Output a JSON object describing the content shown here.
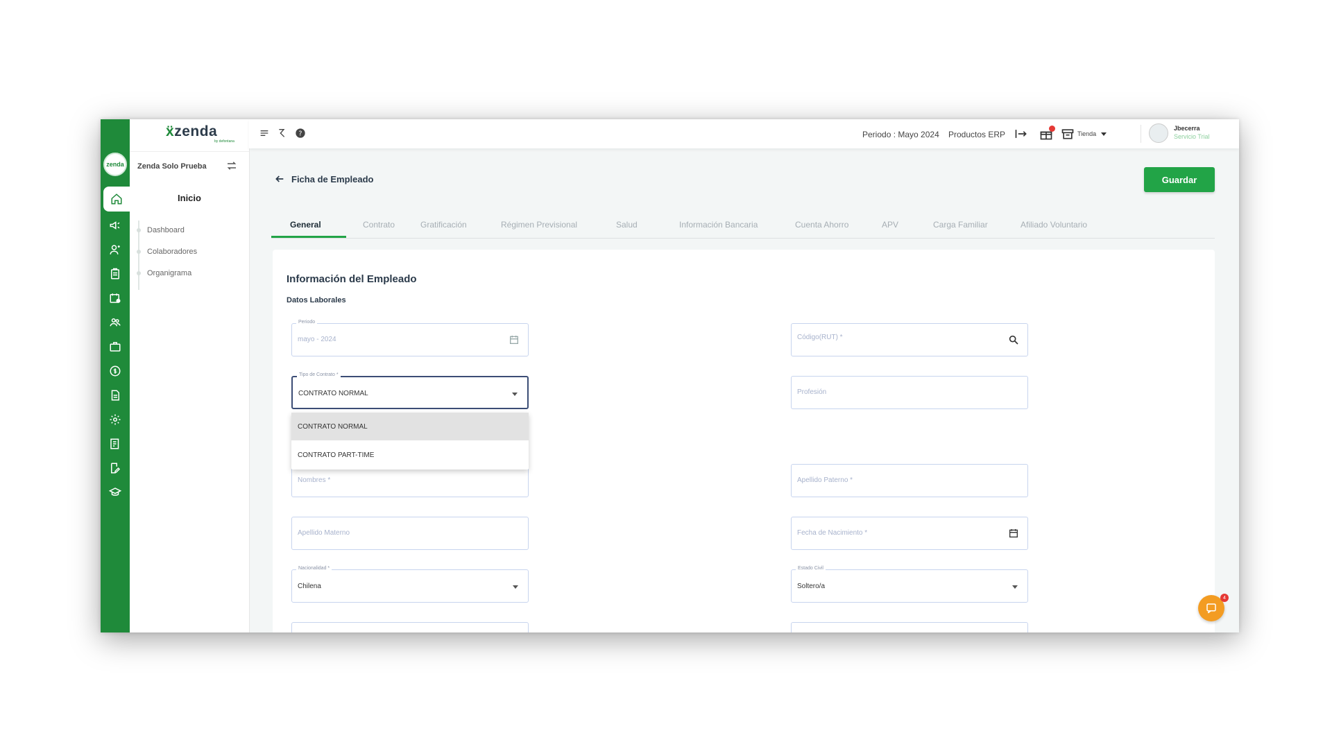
{
  "brand": {
    "logo_text": "zenda",
    "logo_mark": "ẍ",
    "logo_sub": "by defontana",
    "rail_avatar": "zenda"
  },
  "sidebar": {
    "company": "Zenda Solo Prueba",
    "section": "Inicio",
    "items": [
      {
        "label": "Dashboard"
      },
      {
        "label": "Colaboradores"
      },
      {
        "label": "Organigrama"
      }
    ]
  },
  "rail_icons": [
    "home-icon",
    "megaphone-icon",
    "user-add-icon",
    "clipboard-icon",
    "calendar-check-icon",
    "team-icon",
    "briefcase-icon",
    "money-icon",
    "document-icon",
    "settings-icon",
    "report-icon",
    "edit-document-icon",
    "graduation-icon"
  ],
  "topbar": {
    "periodo": "Periodo : Mayo 2024",
    "productos": "Productos ERP",
    "tienda": "Tienda",
    "user_name": "Jbecerra",
    "user_role": "Servicio Trial"
  },
  "header": {
    "title": "Ficha de Empleado",
    "save_label": "Guardar"
  },
  "tabs": [
    {
      "label": "General",
      "active": true
    },
    {
      "label": "Contrato"
    },
    {
      "label": "Gratificación"
    },
    {
      "label": "Régimen Previsional"
    },
    {
      "label": "Salud"
    },
    {
      "label": "Información Bancaria"
    },
    {
      "label": "Cuenta Ahorro"
    },
    {
      "label": "APV"
    },
    {
      "label": "Carga Familiar"
    },
    {
      "label": "Afiliado Voluntario"
    }
  ],
  "form": {
    "section_title": "Información del Empleado",
    "subsection_title": "Datos Laborales",
    "periodo": {
      "label": "Periodo",
      "value": "mayo - 2024"
    },
    "codigo": {
      "placeholder": "Código(RUT) *"
    },
    "tipo_contrato": {
      "label": "Tipo de Contrato *",
      "value": "CONTRATO NORMAL"
    },
    "profesion": {
      "placeholder": "Profesión"
    },
    "nombres": {
      "placeholder": "Nombres *"
    },
    "apellido_paterno": {
      "placeholder": "Apellido Paterno *"
    },
    "apellido_materno": {
      "placeholder": "Apellido Materno"
    },
    "fecha_nacimiento": {
      "placeholder": "Fecha de Nacimiento *"
    },
    "nacionalidad": {
      "label": "Nacionalidad *",
      "value": "Chilena"
    },
    "estado_civil": {
      "label": "Estado Civil",
      "value": "Soltero/a"
    }
  },
  "dropdown": {
    "options": [
      "CONTRATO NORMAL",
      "CONTRATO PART-TIME"
    ],
    "selected_index": 0
  },
  "chat": {
    "badge": "4"
  },
  "colors": {
    "brand_green": "#1f8a3a",
    "button_green": "#22a447",
    "chat_orange": "#f39c22",
    "badge_red": "#e53935"
  }
}
